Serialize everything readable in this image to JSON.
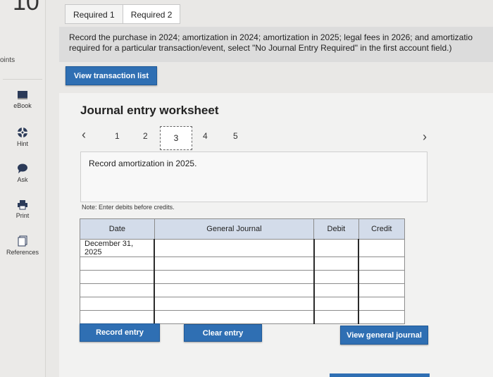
{
  "question_number": "10",
  "left_rail": {
    "points_label": "oints",
    "items": [
      {
        "label": "eBook",
        "icon": "book-icon"
      },
      {
        "label": "Hint",
        "icon": "lifebuoy-icon"
      },
      {
        "label": "Ask",
        "icon": "speech-bubble-icon"
      },
      {
        "label": "Print",
        "icon": "printer-icon"
      },
      {
        "label": "References",
        "icon": "document-stack-icon"
      }
    ]
  },
  "tabs": [
    {
      "label": "Required 1",
      "active": false
    },
    {
      "label": "Required 2",
      "active": true
    }
  ],
  "instructions": {
    "line1": "Record the purchase in 2024; amortization in 2024; amortization in 2025; legal fees in 2026; and amortizatio",
    "line2": "required for a particular transaction/event, select \"No Journal Entry Required\" in the first account field.)"
  },
  "view_transaction_list_label": "View transaction list",
  "worksheet": {
    "title": "Journal entry worksheet",
    "pages": [
      "1",
      "2",
      "3",
      "4",
      "5"
    ],
    "current_page": "3",
    "description": "Record amortization in 2025.",
    "note": "Note: Enter debits before credits."
  },
  "journal_table": {
    "headers": {
      "date": "Date",
      "general_journal": "General Journal",
      "debit": "Debit",
      "credit": "Credit"
    },
    "rows": [
      {
        "date": "December 31, 2025",
        "account": "",
        "debit": "",
        "credit": ""
      },
      {
        "date": "",
        "account": "",
        "debit": "",
        "credit": ""
      },
      {
        "date": "",
        "account": "",
        "debit": "",
        "credit": ""
      },
      {
        "date": "",
        "account": "",
        "debit": "",
        "credit": ""
      },
      {
        "date": "",
        "account": "",
        "debit": "",
        "credit": ""
      },
      {
        "date": "",
        "account": "",
        "debit": "",
        "credit": ""
      }
    ]
  },
  "buttons": {
    "record_entry": "Record entry",
    "clear_entry": "Clear entry",
    "view_general_journal": "View general journal"
  },
  "colors": {
    "accent": "#2f6fb3",
    "header_fill": "#d3dcea"
  }
}
